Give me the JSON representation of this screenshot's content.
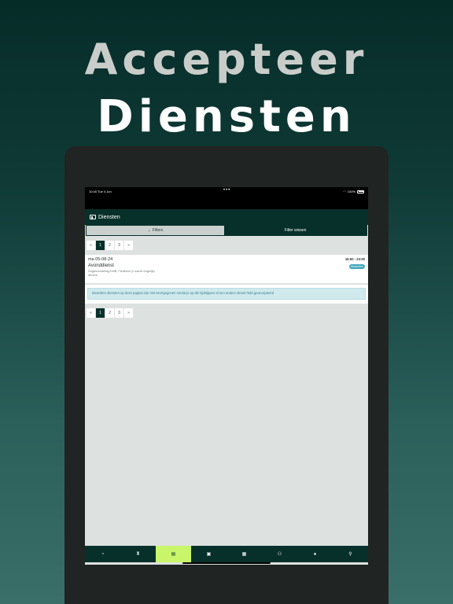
{
  "hero": {
    "line1": "Accepteer",
    "line2": "Diensten"
  },
  "status_bar": {
    "time": "10:45",
    "date": "Tue 4 Jun",
    "battery": "100%"
  },
  "app_bar": {
    "title": "Diensten"
  },
  "filters": {
    "filters_label": "Filters",
    "clear_label": "Filter wissen"
  },
  "pagination": {
    "prev": "«",
    "next": "»",
    "pages": [
      "1",
      "2",
      "3"
    ],
    "current": "1"
  },
  "shift": {
    "date": "ma 05-08-24",
    "title": "Avonddienst",
    "details": "Gegbeoordeling EMB, Flexibeid (1 wacht vingelijk)",
    "location": "Almere",
    "time_range": "15:00 - 23:00",
    "badge": "Afwachten"
  },
  "notice": {
    "text": "Meerdere diensten op deze pagina zijn niet weergegeven omdat je op die tijdstippen al een andere dienst hebt geaccepteerd"
  },
  "bottom_nav": [
    {
      "name": "dashboard",
      "icon": "◔"
    },
    {
      "name": "hourglass",
      "icon": "⧗"
    },
    {
      "name": "shifts",
      "icon": "▤"
    },
    {
      "name": "id-card",
      "icon": "▣"
    },
    {
      "name": "calendar",
      "icon": "▦"
    },
    {
      "name": "team",
      "icon": "⚇"
    },
    {
      "name": "chat",
      "icon": "●"
    },
    {
      "name": "profile",
      "icon": "⚲"
    }
  ],
  "colors": {
    "brand": "#08302b",
    "accent": "#c9f56a",
    "badge": "#3ea6b8",
    "notice_bg": "#cfe9ed"
  }
}
